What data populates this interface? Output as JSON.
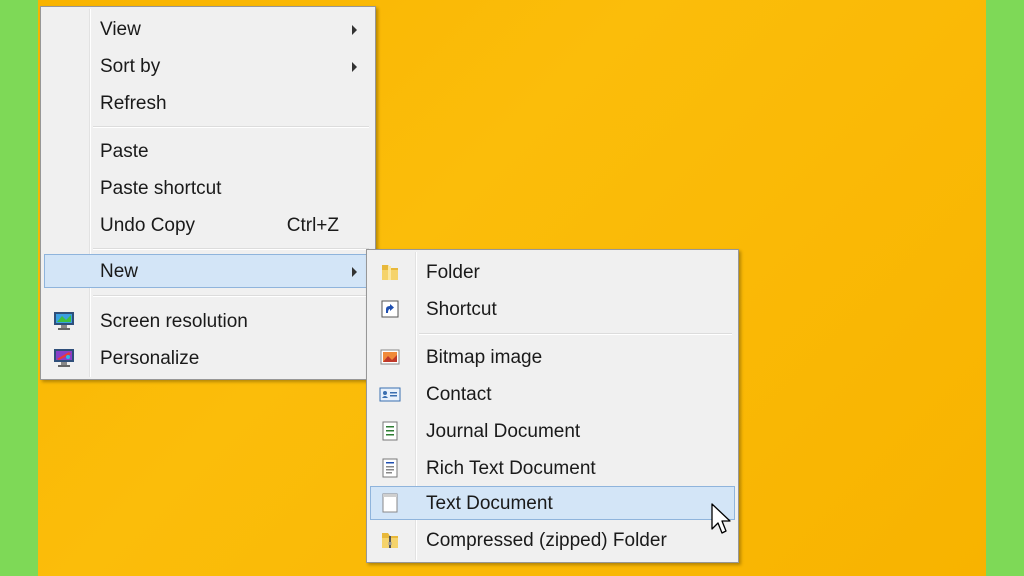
{
  "context_menu": {
    "items": [
      {
        "label": "View",
        "has_submenu": true
      },
      {
        "label": "Sort by",
        "has_submenu": true
      },
      {
        "label": "Refresh"
      },
      {
        "label": "Paste"
      },
      {
        "label": "Paste shortcut"
      },
      {
        "label": "Undo Copy",
        "shortcut": "Ctrl+Z"
      },
      {
        "label": "New",
        "has_submenu": true,
        "highlighted": true
      },
      {
        "label": "Screen resolution",
        "icon": "monitor-icon"
      },
      {
        "label": "Personalize",
        "icon": "personalize-icon"
      }
    ]
  },
  "new_submenu": {
    "items": [
      {
        "label": "Folder",
        "icon": "folder-icon"
      },
      {
        "label": "Shortcut",
        "icon": "shortcut-icon"
      },
      {
        "label": "Bitmap image",
        "icon": "bitmap-icon"
      },
      {
        "label": "Contact",
        "icon": "contact-card-icon"
      },
      {
        "label": "Journal Document",
        "icon": "journal-icon"
      },
      {
        "label": "Rich Text Document",
        "icon": "rich-text-icon"
      },
      {
        "label": "Text Document",
        "icon": "text-document-icon",
        "highlighted": true
      },
      {
        "label": "Compressed (zipped) Folder",
        "icon": "zip-folder-icon"
      }
    ]
  },
  "colors": {
    "desktop": "#fbbd0a",
    "frame": "#7ed957",
    "highlight": "#d3e5f7",
    "highlight_border": "#8fb4dc"
  }
}
